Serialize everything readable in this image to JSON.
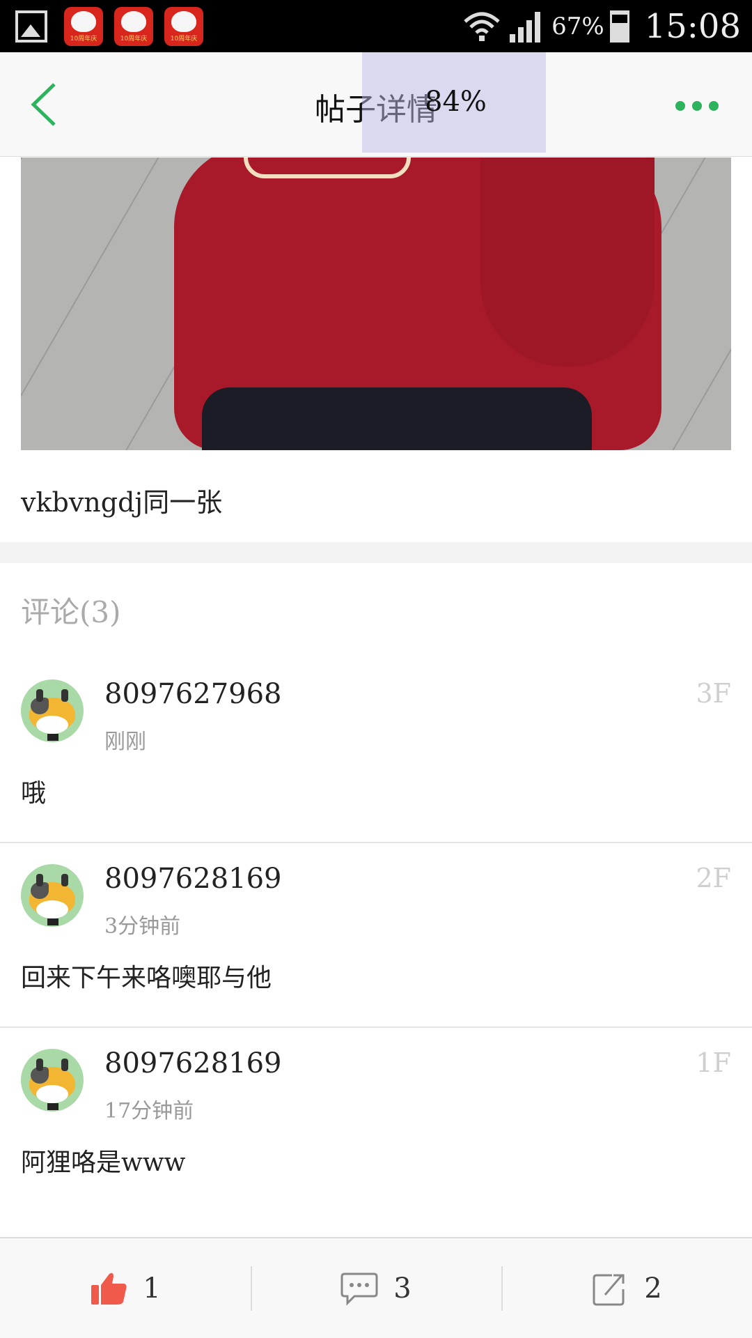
{
  "status_bar": {
    "battery_percent": "67%",
    "battery_level": 0.67,
    "time": "15:08",
    "notification_icons": [
      "gallery-icon",
      "app-notification-icon",
      "app-notification-icon",
      "app-notification-icon"
    ]
  },
  "header": {
    "title": "帖子详情",
    "progress_text": "84%",
    "back_icon": "chevron-left-icon",
    "more_icon": "more-dots-icon",
    "accent_color": "#2db35d"
  },
  "post": {
    "text": "vkbvngdj同一张"
  },
  "comments": {
    "title": "评论(3)",
    "items": [
      {
        "user": "8097627968",
        "time": "刚刚",
        "floor": "3F",
        "text": "哦"
      },
      {
        "user": "8097628169",
        "time": "3分钟前",
        "floor": "2F",
        "text": "回来下午来咯噢耶与他"
      },
      {
        "user": "8097628169",
        "time": "17分钟前",
        "floor": "1F",
        "text": "阿狸咯是www"
      }
    ]
  },
  "bottom_bar": {
    "like_count": "1",
    "comment_count": "3",
    "share_count": "2",
    "like_color": "#f05a4a"
  }
}
